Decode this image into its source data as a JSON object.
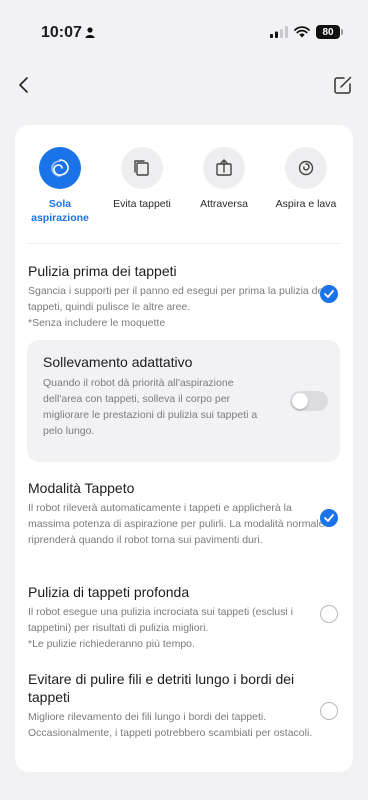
{
  "status_bar": {
    "time": "10:07",
    "battery": "80"
  },
  "modes": [
    {
      "label": "Sola aspirazione",
      "active": true,
      "icon": "swirl-icon"
    },
    {
      "label": "Evita tappeti",
      "active": false,
      "icon": "carpet-avoid-icon"
    },
    {
      "label": "Attraversa",
      "active": false,
      "icon": "cross-carpet-icon"
    },
    {
      "label": "Aspira e lava",
      "active": false,
      "icon": "vacuum-mop-icon"
    }
  ],
  "options": {
    "pulizia_prima": {
      "title": "Pulizia prima dei tappeti",
      "desc": "Sgancia i supporti per il panno ed esegui per prima la pulizia dei tappeti, quindi pulisce le altre aree.",
      "note": "*Senza includere le moquette",
      "checked": true
    },
    "sollevamento": {
      "title": "Sollevamento adattativo",
      "desc": "Quando il robot dà priorità all'aspirazione dell'area con tappeti, solleva il corpo per migliorare le prestazioni di pulizia sui tappeti a pelo lungo.",
      "enabled": false
    },
    "modalita_tappeto": {
      "title": "Modalità Tappeto",
      "desc": "Il robot rileverà automaticamente i tappeti e applicherà la massima potenza di aspirazione per pulirli. La modalità normale riprenderà quando il robot torna sui pavimenti duri.",
      "checked": true
    },
    "profonda": {
      "title": "Pulizia di tappeti profonda",
      "desc": "Il robot esegue una pulizia incrociata sui tappeti (esclusi i tappetini) per risultati di pulizia migliori.",
      "note": "*Le pulizie richiederanno più tempo.",
      "checked": false
    },
    "fili": {
      "title": "Evitare di pulire fili e detriti lungo i bordi dei tappeti",
      "desc": "Migliore rilevamento dei fili lungo i bordi dei tappeti. Occasionalmente, i tappeti potrebbero scambiati per ostacoli.",
      "checked": false
    }
  },
  "colors": {
    "accent": "#1a73e8",
    "background": "#f2f2f4",
    "card": "#ffffff"
  }
}
